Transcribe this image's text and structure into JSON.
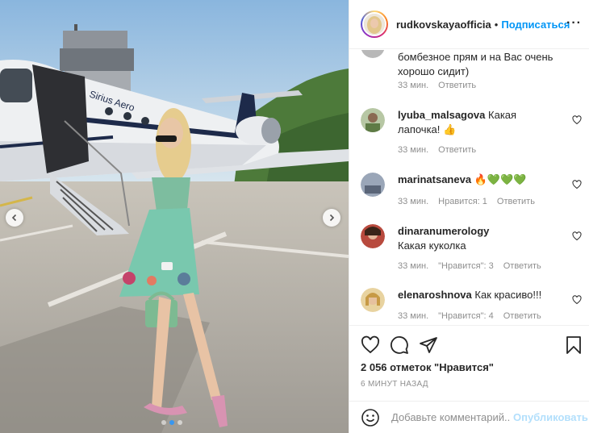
{
  "post": {
    "image_alt": "",
    "brand_on_plane": "Sirius Aero",
    "carousel": {
      "count": 3,
      "active_index": 1
    }
  },
  "header": {
    "username": "rudkovskayaofficia",
    "separator": "•",
    "follow_label": "Подписаться",
    "more_label": "···"
  },
  "comments": [
    {
      "user": "",
      "text": "бомбезное прям и на Вас очень хорошо сидит)",
      "time": "33 мин.",
      "likes": "",
      "reply": "Ответить"
    },
    {
      "user": "lyuba_malsagova",
      "text": "Какая лапочка! 👍",
      "time": "33 мин.",
      "likes": "",
      "reply": "Ответить"
    },
    {
      "user": "marinatsaneva",
      "text": "🔥💚💚💚",
      "time": "33 мин.",
      "likes": "Нравится: 1",
      "reply": "Ответить"
    },
    {
      "user": "dinaranumerology",
      "text": "Какая куколка",
      "time": "33 мин.",
      "likes": "\"Нравится\": 3",
      "reply": "Ответить"
    },
    {
      "user": "elenaroshnova",
      "text": "Как красиво!!!",
      "time": "33 мин.",
      "likes": "\"Нравится\": 4",
      "reply": "Ответить"
    }
  ],
  "actions": {
    "likes_text": "2 056 отметок \"Нравится\"",
    "time_text": "6 МИНУТ НАЗАД"
  },
  "add_comment": {
    "placeholder": "Добавьте комментарий...",
    "publish_label": "Опубликовать"
  },
  "colors": {
    "accent": "#0095f6",
    "publish_disabled": "#b2dffc",
    "muted": "#8e8e8e",
    "text": "#262626",
    "carousel_dot_active": "#3897f0"
  },
  "icons": [
    "chevron-left-icon",
    "chevron-right-icon",
    "heart-icon",
    "comment-icon",
    "share-icon",
    "bookmark-icon",
    "emoji-icon",
    "more-icon"
  ]
}
